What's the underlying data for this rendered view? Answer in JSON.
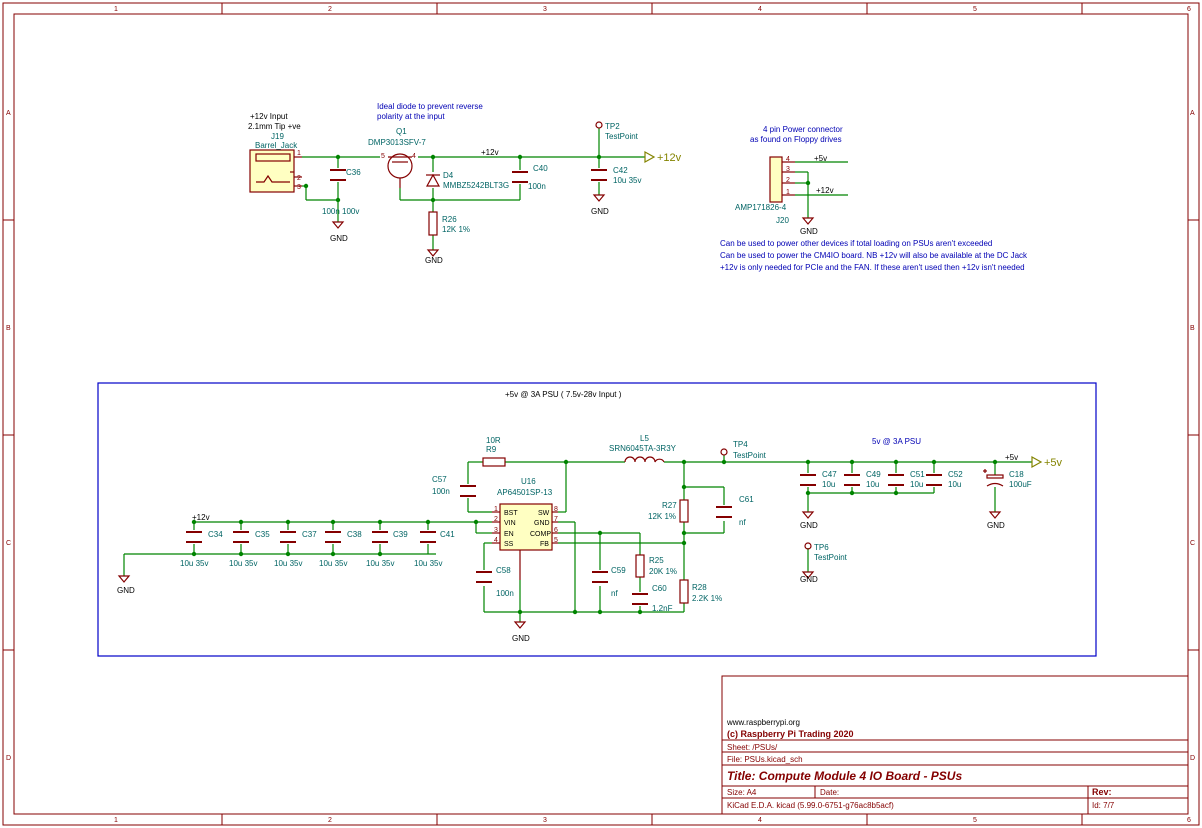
{
  "frame": {
    "columns": [
      "1",
      "2",
      "3",
      "4",
      "5",
      "6"
    ],
    "rows": [
      "A",
      "B",
      "C",
      "D"
    ]
  },
  "title_block": {
    "url": "www.raspberrypi.org",
    "company": "(c) Raspberry Pi Trading 2020",
    "sheet": "Sheet: /PSUs/",
    "file": "File: PSUs.kicad_sch",
    "title": "Title: Compute Module 4 IO Board - PSUs",
    "size": "Size: A4",
    "date": "Date:",
    "rev": "Rev:",
    "tool": "KiCad E.D.A.  kicad (5.99.0-6751-g76ac8b5acf)",
    "id": "Id: 7/7"
  },
  "input_section": {
    "j19_note1": "+12v Input",
    "j19_note2": "2.1mm Tip +ve",
    "j19_ref": "J19",
    "j19_val": "Barrel_Jack",
    "diode_note1": "Ideal diode to prevent reverse",
    "diode_note2": "polarity at the input",
    "q1_ref": "Q1",
    "q1_val": "DMP3013SFV-7",
    "d4_ref": "D4",
    "d4_val": "MMBZ5242BLT3G",
    "c36_ref": "C36",
    "c36_val": "100n 100v",
    "c40_ref": "C40",
    "c40_val": "100n",
    "r26_ref": "R26",
    "r26_val": "12K 1%",
    "tp2_ref": "TP2",
    "tp2_val": "TestPoint",
    "c42_ref": "C42",
    "c42_val": "10u 35v",
    "net_12v": "+12v",
    "power_12v": "+12v",
    "gnd": "GND"
  },
  "power_connector": {
    "note1": "4 pin Power connector",
    "note2": "as found on Floppy drives",
    "ref": "J20",
    "val": "AMP171826-4",
    "net_5v": "+5v",
    "net_12v": "+12v",
    "gnd": "GND",
    "pins": [
      "4",
      "3",
      "2",
      "1"
    ],
    "usage1": "Can be used to power other devices if total loading on PSUs aren't exceeded",
    "usage2": "Can be used to power the CM4IO board. NB +12v will also be available at the DC Jack",
    "usage3": "+12v is only needed for PCIe and the FAN. If these aren't used then +12v isn't needed"
  },
  "psu_section": {
    "heading": "+5v @ 3A PSU ( 7.5v-28v Input )",
    "output_label": "5v @ 3A PSU",
    "u16_ref": "U16",
    "u16_val": "AP64501SP-13",
    "u16_pins_left": [
      "BST",
      "VIN",
      "EN",
      "SS"
    ],
    "u16_pins_right": [
      "SW",
      "GND",
      "COMP",
      "FB"
    ],
    "u16_pin_nums_left": [
      "1",
      "2",
      "3",
      "4"
    ],
    "u16_pin_nums_right": [
      "8",
      "7",
      "6",
      "5"
    ],
    "r9_ref": "R9",
    "r9_val": "10R",
    "l5_ref": "L5",
    "l5_val": "SRN6045TA-3R3Y",
    "tp4_ref": "TP4",
    "tp4_val": "TestPoint",
    "tp6_ref": "TP6",
    "tp6_val": "TestPoint",
    "c57_ref": "C57",
    "c57_val": "100n",
    "c58_ref": "C58",
    "c58_val": "100n",
    "c59_ref": "C59",
    "c59_val": "nf",
    "c60_ref": "C60",
    "c60_val": "1.2nF",
    "c61_ref": "C61",
    "c61_val": "nf",
    "r25_ref": "R25",
    "r25_val": "20K 1%",
    "r27_ref": "R27",
    "r27_val": "12K 1%",
    "r28_ref": "R28",
    "r28_val": "2.2K 1%",
    "input_caps": [
      {
        "ref": "C34",
        "val": "10u 35v"
      },
      {
        "ref": "C35",
        "val": "10u 35v"
      },
      {
        "ref": "C37",
        "val": "10u 35v"
      },
      {
        "ref": "C38",
        "val": "10u 35v"
      },
      {
        "ref": "C39",
        "val": "10u 35v"
      },
      {
        "ref": "C41",
        "val": "10u 35v"
      }
    ],
    "output_caps": [
      {
        "ref": "C47",
        "val": "10u"
      },
      {
        "ref": "C49",
        "val": "10u"
      },
      {
        "ref": "C51",
        "val": "10u"
      },
      {
        "ref": "C52",
        "val": "10u"
      }
    ],
    "c18_ref": "C18",
    "c18_val": "100uF",
    "net_12v": "+12v",
    "net_5v": "+5v",
    "power_5v": "+5v",
    "gnd": "GND"
  },
  "colors": {
    "wire": "#008400",
    "component": "#840000",
    "text_ref": "#006464",
    "note": "#0000b4",
    "power": "#848400",
    "sheet_box": "#0000c8"
  }
}
